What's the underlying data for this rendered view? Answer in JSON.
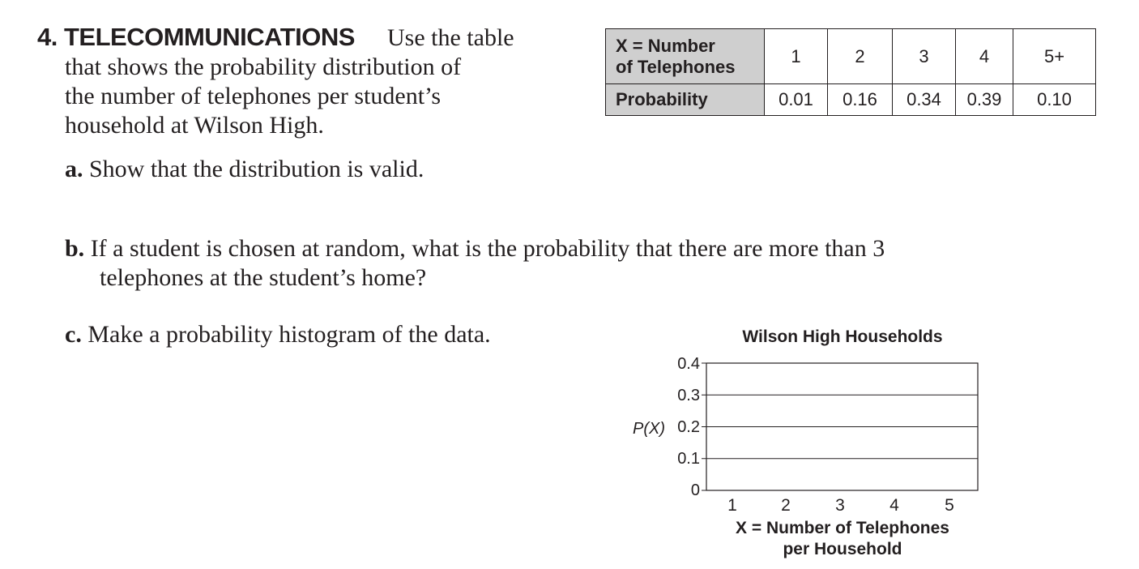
{
  "problem": {
    "number_title": "4. TELECOMMUNICATIONS",
    "lines": [
      "Use the table",
      "that shows the probability distribution of",
      "the number of telephones per student’s",
      "household at Wilson High."
    ]
  },
  "parts": {
    "a": {
      "label": "a.",
      "text": "Show that the distribution is valid."
    },
    "b": {
      "label": "b.",
      "line1": "If a student is chosen at random, what is the probability that there are more than 3",
      "line2": "telephones at the student’s home?"
    },
    "c": {
      "label": "c.",
      "text": "Make a probability histogram of the data."
    }
  },
  "table": {
    "header_row": {
      "label_line1": "X = Number",
      "label_line2": "of Telephones",
      "values": [
        "1",
        "2",
        "3",
        "4",
        "5+"
      ]
    },
    "prob_row": {
      "label": "Probability",
      "values": [
        "0.01",
        "0.16",
        "0.34",
        "0.39",
        "0.10"
      ]
    },
    "header_bg": "#cfcfcf"
  },
  "chart_data": {
    "type": "bar",
    "title": "Wilson High Households",
    "xlabel": "X = Number of Telephones per Household",
    "xlabel_line1": "X = Number of Telephones",
    "xlabel_line2": "per Household",
    "ylabel": "P(X)",
    "categories": [
      "1",
      "2",
      "3",
      "4",
      "5"
    ],
    "values": [],
    "ylim": [
      0,
      0.4
    ],
    "yticks": [
      "0",
      "0.1",
      "0.2",
      "0.3",
      "0.4"
    ],
    "grid": true
  }
}
